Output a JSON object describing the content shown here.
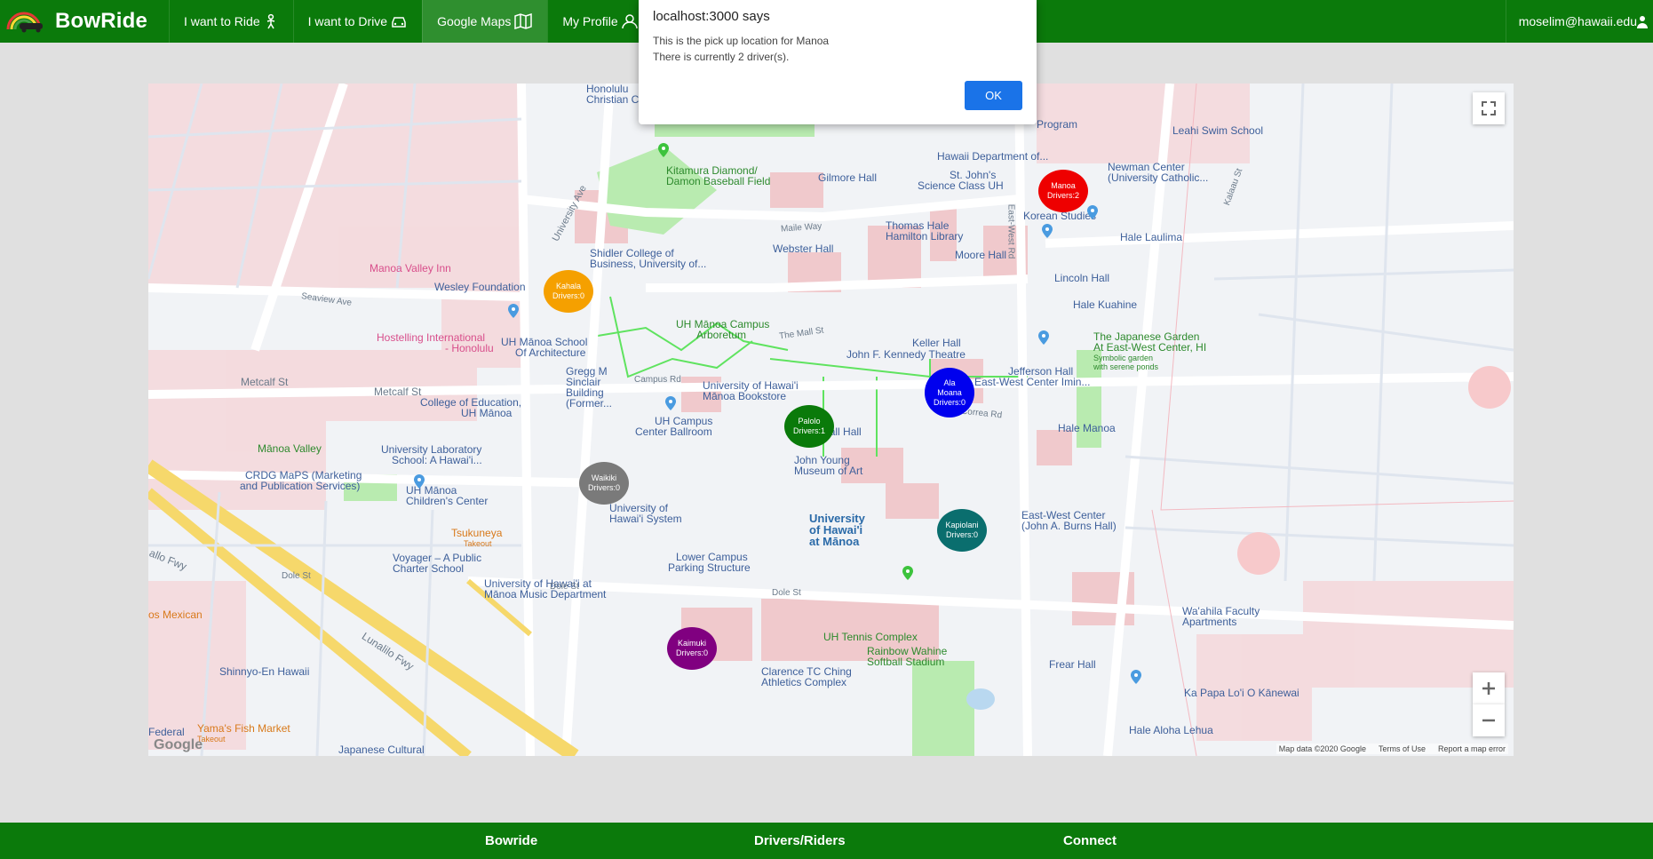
{
  "navbar": {
    "brand": "BowRide",
    "items": [
      {
        "label": "I want to Ride",
        "icon": "person-icon"
      },
      {
        "label": "I want to Drive",
        "icon": "car-icon"
      },
      {
        "label": "Google Maps",
        "icon": "map-icon",
        "active": true
      },
      {
        "label": "My Profile",
        "icon": "user-icon"
      }
    ],
    "user": "moselim@hawaii.edu"
  },
  "dialog": {
    "title": "localhost:3000 says",
    "line1": "This is the pick up location for Manoa",
    "line2": "There is currently 2 driver(s).",
    "ok_label": "OK"
  },
  "pickups": [
    {
      "name": "Manoa",
      "drivers": "Drivers:2",
      "color": "#ee0000"
    },
    {
      "name": "Kahala",
      "drivers": "Drivers:0",
      "color": "#f5a000"
    },
    {
      "name": "Ala Moana",
      "drivers": "Drivers:0",
      "color": "#0000ee"
    },
    {
      "name": "Palolo",
      "drivers": "Drivers:1",
      "color": "#0a7a0a"
    },
    {
      "name": "Waikiki",
      "drivers": "Drivers:0",
      "color": "#7a7a7a"
    },
    {
      "name": "Kapiolani",
      "drivers": "Drivers:0",
      "color": "#0a6e6e"
    },
    {
      "name": "Kaimuki",
      "drivers": "Drivers:0",
      "color": "#800080"
    }
  ],
  "map_labels": {
    "kitamura": "Kitamura Diamond/",
    "kitamura2": "Damon Baseball Field",
    "gilmore": "Gilmore Hall",
    "thomas": "Thomas Hale",
    "hamilton": "Hamilton Library",
    "moore": "Moore Hall",
    "webster": "Webster Hall",
    "shidler": "Shidler College of",
    "shidler2": "Business, University of...",
    "manoa_valley_inn": "Manoa Valley Inn",
    "wesley": "Wesley Foundation",
    "hostelling": "Hostelling International",
    "hostelling2": "- Honolulu",
    "arboretum": "UH Mānoa Campus",
    "arboretum2": "Arboretum",
    "architecture": "UH Mānoa School",
    "architecture2": "Of Architecture",
    "gregg": "Gregg M",
    "gregg2": "Sinclair",
    "gregg3": "Building",
    "gregg4": "(Former...",
    "bookstore": "University of Hawai'i",
    "bookstore2": "Mānoa Bookstore",
    "ballroom": "UH Campus",
    "ballroom2": "Center Ballroom",
    "kuykendall": "Kuykendall Hall",
    "keller": "Keller Hall",
    "kennedy": "John F. Kennedy Theatre",
    "jefferson": "Jefferson Hall",
    "eastwest": "East-West Center Imin...",
    "japanese": "The Japanese Garden",
    "japanese2": "At East-West Center, HI",
    "japanese3": "Symbolic garden",
    "japanese4": "with serene ponds",
    "hale_manoa": "Hale Manoa",
    "hale_kuahine": "Hale Kuahine",
    "lincoln": "Lincoln Hall",
    "hale_laulima": "Hale Laulima",
    "korean": "Korean Studies",
    "st_johns": "St. John's",
    "science": "Science Class UH",
    "newman": "Newman Center",
    "newman2": "(University Catholic...",
    "leahi": "Leahi Swim School",
    "hawaii_dept": "Hawaii Department of...",
    "program": "Program",
    "education": "College of Education,",
    "education2": "UH Mānoa",
    "lab_school": "University Laboratory",
    "lab_school2": "School: A Hawai'i...",
    "manoa_valley": "Mānoa Valley",
    "crdg": "CRDG MaPS (Marketing",
    "crdg2": "and Publication Services)",
    "childrens": "UH Mānoa",
    "childrens2": "Children's Center",
    "museum": "John Young",
    "museum2": "Museum of Art",
    "uh_system": "University of",
    "uh_system2": "Hawai'i System",
    "uh_manoa": "University",
    "uh_manoa2": "of Hawai'i",
    "uh_manoa3": "at Mānoa",
    "kapiolani_ew": "East-West Center",
    "kapiolani_ew2": "(John A. Burns Hall)",
    "tsukuneya": "Tsukuneya",
    "tsukuneya2": "Takeout",
    "voyager": "Voyager – A Public",
    "voyager2": "Charter School",
    "music": "University of Hawai'i at",
    "music2": "Mānoa Music Department",
    "lower_campus": "Lower Campus",
    "lower_campus2": "Parking Structure",
    "tennis": "UH Tennis Complex",
    "softball": "Rainbow Wahine",
    "softball2": "Softball Stadium",
    "athletics": "Clarence TC Ching",
    "athletics2": "Athletics Complex",
    "shinnyo": "Shinnyo-En Hawaii",
    "yamas": "Yama's Fish Market",
    "yamas2": "Takeout",
    "japanese_cultural": "Japanese Cultural",
    "federal": "Federal",
    "mexican": "os Mexican",
    "frear": "Frear Hall",
    "wa_ahila": "Wa'ahila Faculty",
    "wa_ahila2": "Apartments",
    "ka_papa": "Ka Papa Lo'i O Kānewai",
    "hale_aloha": "Hale Aloha Lehua",
    "honolulu_christian": "Honolulu",
    "honolulu_christian2": "Christian Ch",
    "metcalf_st": "Metcalf St",
    "metcalf_st2": "Metcalf St",
    "campus_rd": "Campus Rd",
    "dole_st": "Dole St",
    "dole_st2": "Dole St",
    "dole_st3": "Dole St",
    "lunalilo": "Lunalilo Fwy",
    "lunalilo2": "allo Fwy",
    "maile": "Maile Way",
    "mall": "The Mall St",
    "correa": "Correa Rd",
    "university_ave": "University Ave",
    "eastwest_rd": "East-West Rd",
    "seaview": "Seaview Ave",
    "kalaau": "Kalaau St"
  },
  "map_footer": {
    "data": "Map data ©2020 Google",
    "terms": "Terms of Use",
    "report": "Report a map error",
    "logo": "Google"
  },
  "footer": {
    "col1": "Bowride",
    "col2": "Drivers/Riders",
    "col3": "Connect"
  }
}
